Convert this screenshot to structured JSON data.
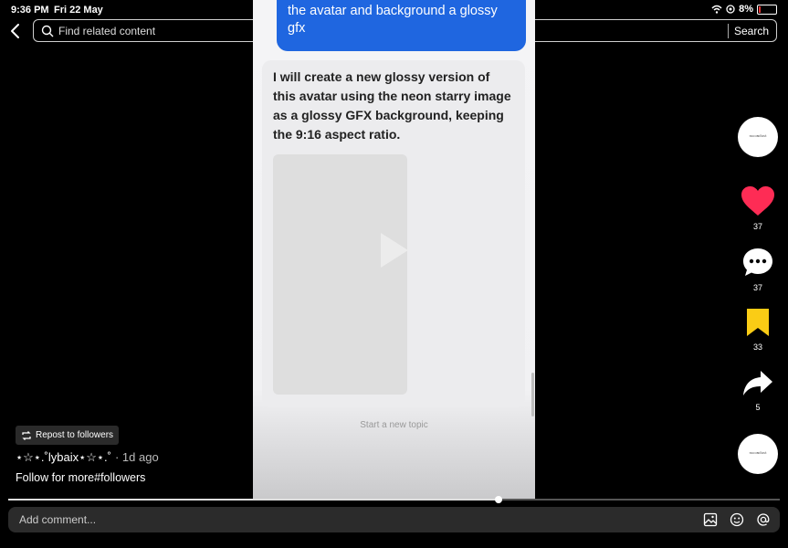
{
  "status_bar": {
    "time": "9:36 PM",
    "date": "Fri 22 May",
    "battery": "8%"
  },
  "search": {
    "placeholder": "Find related content",
    "button": "Search"
  },
  "video": {
    "user_message": "the picture one make it background for the avatar and background a glossy gfx",
    "assistant_message": "I will create a new glossy version of this avatar using the neon starry image as a glossy GFX background, keeping the 9:16 aspect ratio.",
    "new_topic": "Start a new topic"
  },
  "rail": {
    "avatar_text": "ᵐᵒᵒᶰᵈᵘˢᵗ",
    "likes": "37",
    "comments": "37",
    "saves": "33",
    "shares": "5",
    "sound_avatar_text": "ᵐᵒᵒᶰᵈᵘˢᵗ"
  },
  "post": {
    "repost_label": "Repost to followers",
    "author": "⋆☆⋆.˚lybaix⋆☆⋆.˚",
    "time": "· 1d ago",
    "caption": "Follow for more#followers"
  },
  "progress": {
    "value": 0.635
  },
  "comment": {
    "placeholder": "Add comment..."
  },
  "colors": {
    "like": "#fe2c55",
    "save": "#facc15",
    "user_bubble": "#1f66e0"
  }
}
